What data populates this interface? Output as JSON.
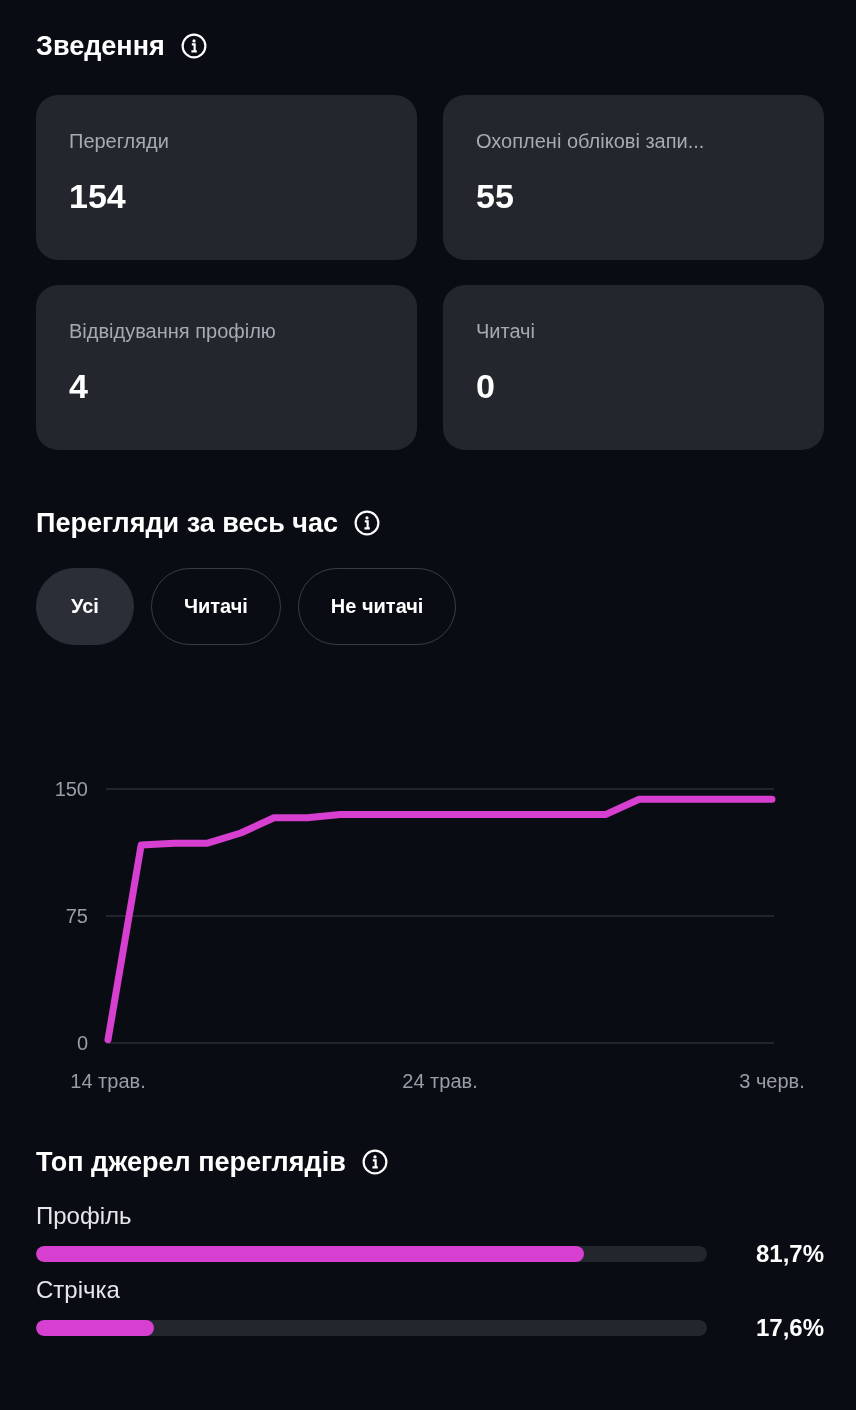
{
  "summary": {
    "title": "Зведення",
    "cards": [
      {
        "label": "Перегляди",
        "value": "154"
      },
      {
        "label": "Охоплені облікові запи...",
        "value": "55"
      },
      {
        "label": "Відвідування профілю",
        "value": "4"
      },
      {
        "label": "Читачі",
        "value": "0"
      }
    ]
  },
  "views": {
    "title": "Перегляди за весь час",
    "filters": [
      {
        "label": "Усі",
        "selected": true
      },
      {
        "label": "Читачі",
        "selected": false
      },
      {
        "label": "Не читачі",
        "selected": false
      }
    ],
    "chart_data": {
      "type": "line",
      "categories": [
        "14 трав.",
        null,
        null,
        null,
        null,
        null,
        null,
        null,
        null,
        null,
        "24 трав.",
        null,
        null,
        null,
        null,
        null,
        null,
        null,
        null,
        null,
        "3 черв."
      ],
      "series": [
        {
          "color": "#d63fd0",
          "values": [
            2,
            117,
            118,
            118,
            124,
            133,
            133,
            135,
            135,
            135,
            135,
            135,
            135,
            135,
            135,
            135,
            144,
            144,
            144,
            144,
            144
          ]
        }
      ],
      "ylim": [
        0,
        150
      ],
      "yticks": [
        0,
        75,
        150
      ]
    }
  },
  "sources": {
    "title": "Топ джерел переглядів",
    "items": [
      {
        "label": "Профіль",
        "level": 0.817,
        "reading": "81,7%"
      },
      {
        "label": "Стрічка",
        "level": 0.176,
        "reading": "17,6%"
      }
    ]
  }
}
